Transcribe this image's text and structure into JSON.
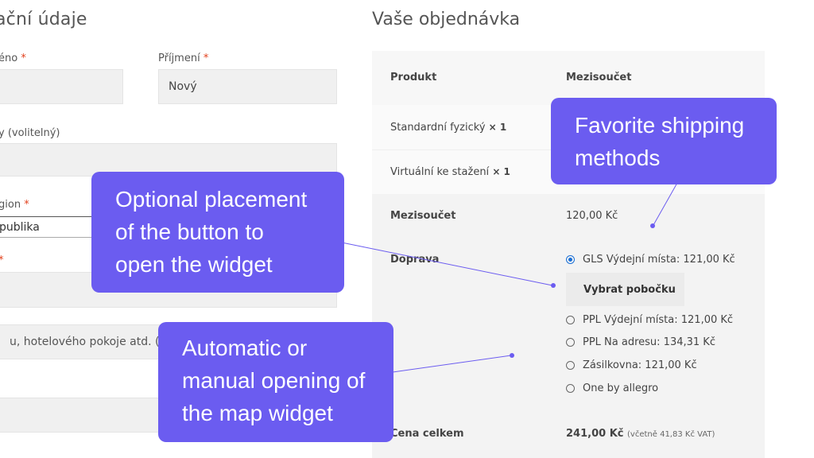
{
  "billing": {
    "title": "ační údaje",
    "first_name": {
      "label": "éno",
      "required": "*"
    },
    "last_name": {
      "label": "Příjmení",
      "required": "*",
      "value": "Nový"
    },
    "company": {
      "label": "y (volitelný)"
    },
    "country": {
      "label": "gion",
      "required": "*",
      "value": "publika"
    },
    "street": {
      "label": "",
      "required": "*"
    },
    "address2": {
      "placeholder": "u, hotelového pokoje atd. (nepo"
    }
  },
  "order": {
    "title": "Vaše objednávka",
    "col_product": "Produkt",
    "col_subtotal": "Mezisoučet",
    "items": [
      {
        "name": "Standardní fyzický",
        "qty": "× 1"
      },
      {
        "name": "Virtuální ke stažení",
        "qty": "× 1"
      }
    ],
    "subtotal_label": "Mezisoučet",
    "subtotal_value": "120,00 Kč",
    "shipping_label": "Doprava",
    "shipping_options": [
      {
        "label": "GLS Výdejní místa: 121,00 Kč",
        "selected": true
      },
      {
        "label": "PPL Výdejní místa: 121,00 Kč",
        "selected": false
      },
      {
        "label": "PPL Na adresu: 134,31 Kč",
        "selected": false
      },
      {
        "label": "Zásilkovna: 121,00 Kč",
        "selected": false
      },
      {
        "label": "One by allegro",
        "selected": false
      }
    ],
    "pick_branch_button": "Vybrat pobočku",
    "total_label": "Cena celkem",
    "total_value": "241,00 Kč",
    "total_vat_note": "(včetně 41,83 Kč VAT)"
  },
  "callouts": {
    "favorite": [
      "Favorite shipping",
      "methods"
    ],
    "placement": [
      "Optional placement",
      "of the button to",
      "open the widget"
    ],
    "opening": [
      "Automatic or",
      "manual opening of",
      "the map widget"
    ]
  },
  "colors": {
    "callout_bg": "#6b5cf0",
    "required": "#e2401c",
    "radio_selected": "#1a6fd6"
  }
}
